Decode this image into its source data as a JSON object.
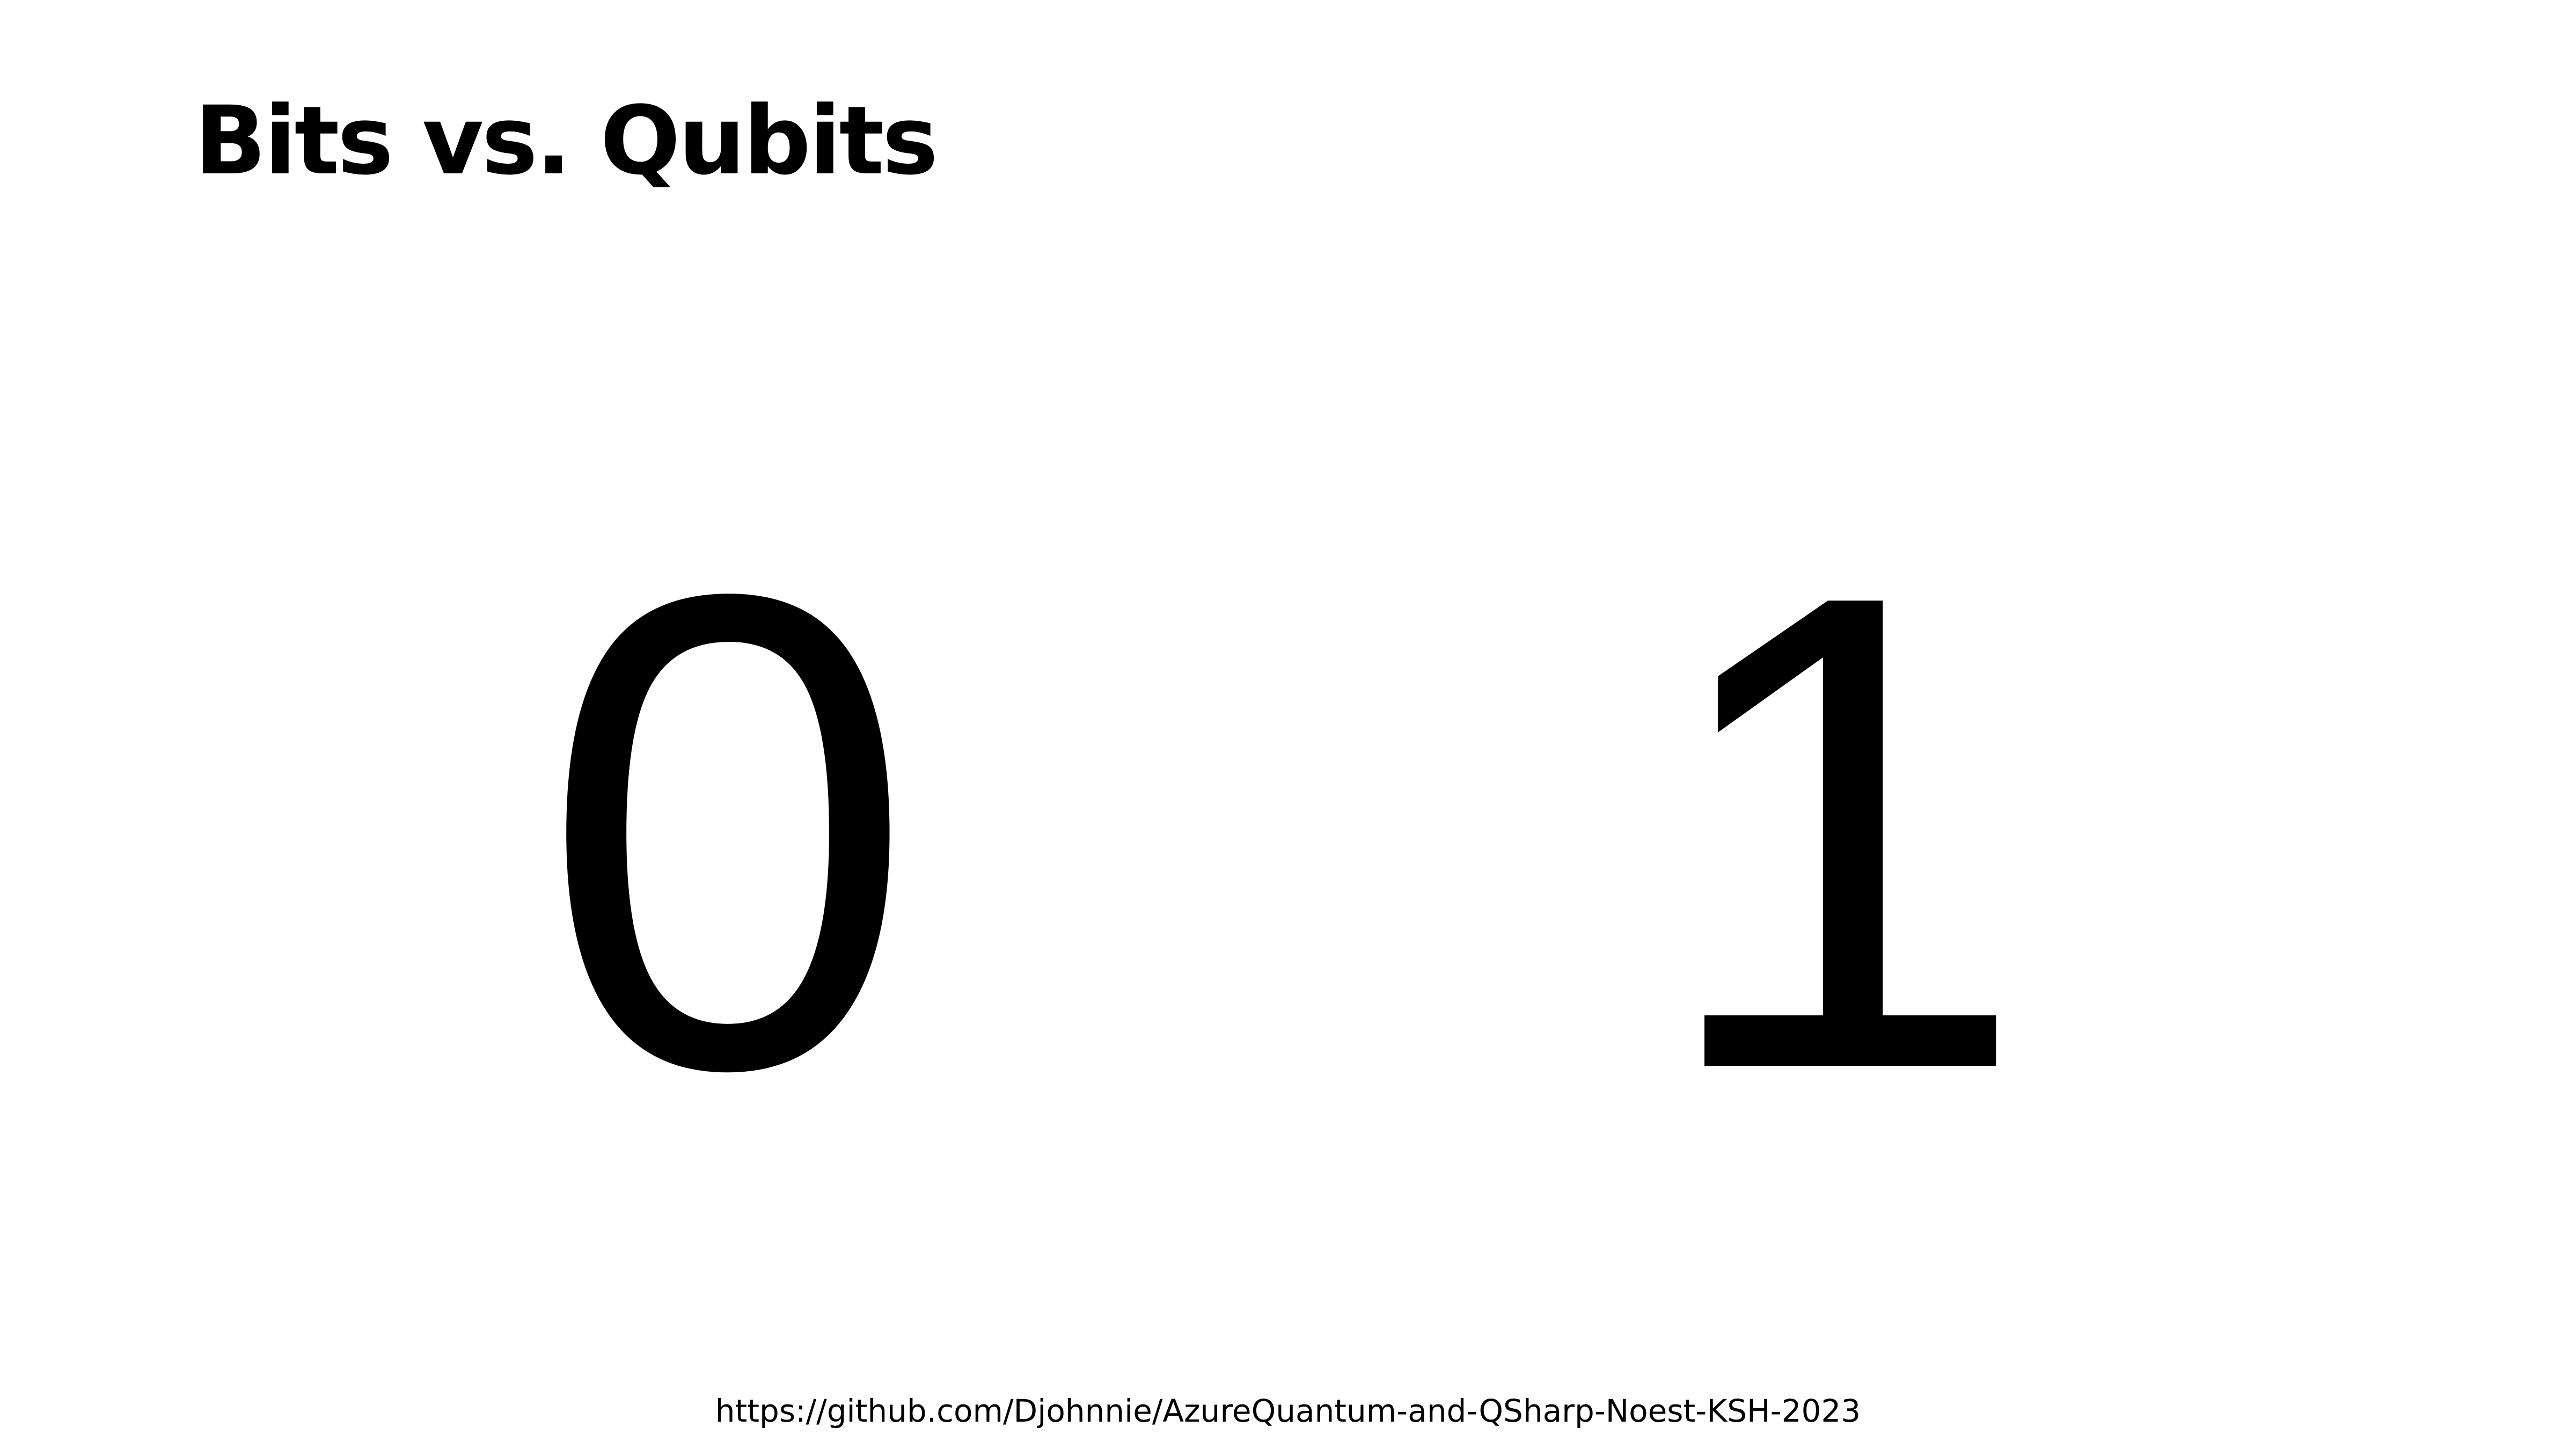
{
  "slide": {
    "title": "Bits vs. Qubits",
    "left_digit": "0",
    "right_digit": "1",
    "footer_url": "https://github.com/Djohnnie/AzureQuantum-and-QSharp-Noest-KSH-2023"
  },
  "colors": {
    "background": "#ffffff",
    "text": "#000000"
  }
}
